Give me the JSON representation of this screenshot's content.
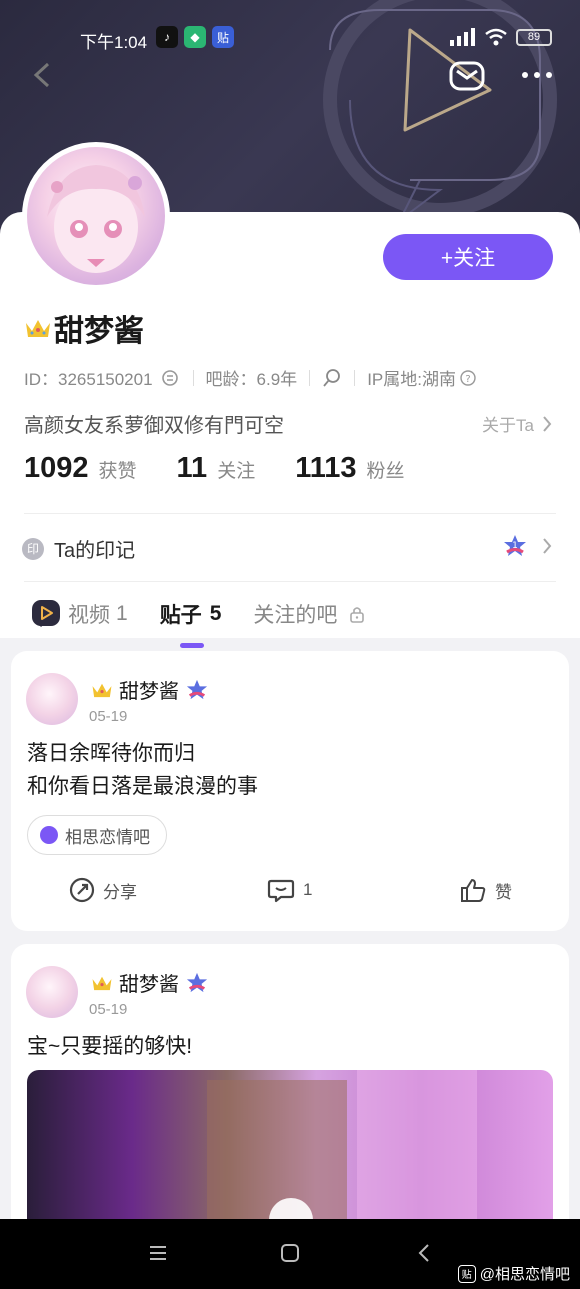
{
  "status_bar": {
    "time": "下午1:04",
    "battery": "89"
  },
  "profile": {
    "username": "甜梦酱",
    "id": "ID：3265150201",
    "bar_age": "吧龄：6.9年",
    "ip_location": "IP属地:湖南",
    "bio": "高颜女友系萝御双修有門可空",
    "about_label": "关于Ta",
    "follow_label": "+关注",
    "stats": [
      {
        "num": "1092",
        "label": "获赞"
      },
      {
        "num": "11",
        "label": "关注"
      },
      {
        "num": "1113",
        "label": "粉丝"
      }
    ],
    "marks_label": "Ta的印记",
    "marks_badge": "印",
    "level_badge": "1"
  },
  "tabs": [
    {
      "label": "视频",
      "count": "1"
    },
    {
      "label": "贴子",
      "count": "5"
    },
    {
      "label": "关注的吧",
      "count": ""
    }
  ],
  "posts": [
    {
      "author": "甜梦酱",
      "date": "05-19",
      "lines": [
        "落日余晖待你而归",
        "和你看日落是最浪漫的事"
      ],
      "forum": "相思恋情吧",
      "share_label": "分享",
      "comment_count": "1",
      "like_label": "赞"
    },
    {
      "author": "甜梦酱",
      "date": "05-19",
      "lines": [
        "宝~只要摇的够快!"
      ]
    }
  ],
  "watermark": {
    "icon_text": "贴",
    "text": "@相思恋情吧"
  },
  "colors": {
    "accent": "#7b57f5",
    "banner": "#2e2d44"
  }
}
